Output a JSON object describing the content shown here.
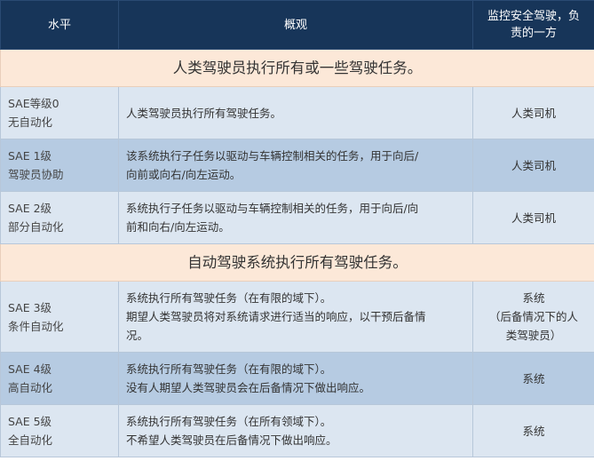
{
  "header": {
    "level": "水平",
    "overview": "概观",
    "monitor_line1": "监控安全驾驶，负",
    "monitor_line2": "责的一方"
  },
  "sections": [
    {
      "title": "人类驾驶员执行所有或一些驾驶任务。",
      "rows": [
        {
          "level_lines": [
            "SAE等级0",
            "无自动化"
          ],
          "overview_lines": [
            "人类驾驶员执行所有驾驶任务。"
          ],
          "monitor_lines": [
            "人类司机"
          ]
        },
        {
          "level_lines": [
            "SAE 1级",
            "驾驶员协助"
          ],
          "overview_lines": [
            "该系统执行子任务以驱动与车辆控制相关的任务，用于向后/",
            "向前或向右/向左运动。"
          ],
          "monitor_lines": [
            "人类司机"
          ]
        },
        {
          "level_lines": [
            "SAE 2级",
            "部分自动化"
          ],
          "overview_lines": [
            "系统执行子任务以驱动与车辆控制相关的任务，用于向后/向",
            "前和向右/向左运动。"
          ],
          "monitor_lines": [
            "人类司机"
          ]
        }
      ]
    },
    {
      "title": "自动驾驶系统执行所有驾驶任务。",
      "rows": [
        {
          "level_lines": [
            "SAE 3级",
            "条件自动化"
          ],
          "overview_lines": [
            "系统执行所有驾驶任务（在有限的域下）。",
            "期望人类驾驶员将对系统请求进行适当的响应，以干预后备情",
            "况。"
          ],
          "monitor_lines": [
            "系统",
            "（后备情况下的人",
            "类驾驶员）"
          ]
        },
        {
          "level_lines": [
            "SAE 4级",
            "高自动化"
          ],
          "overview_lines": [
            "系统执行所有驾驶任务（在有限的域下）。",
            "没有人期望人类驾驶员会在后备情况下做出响应。"
          ],
          "monitor_lines": [
            "系统"
          ]
        },
        {
          "level_lines": [
            "SAE 5级",
            "全自动化"
          ],
          "overview_lines": [
            "系统执行所有驾驶任务（在所有领域下）。",
            "不希望人类驾驶员在后备情况下做出响应。"
          ],
          "monitor_lines": [
            "系统"
          ]
        }
      ]
    }
  ]
}
